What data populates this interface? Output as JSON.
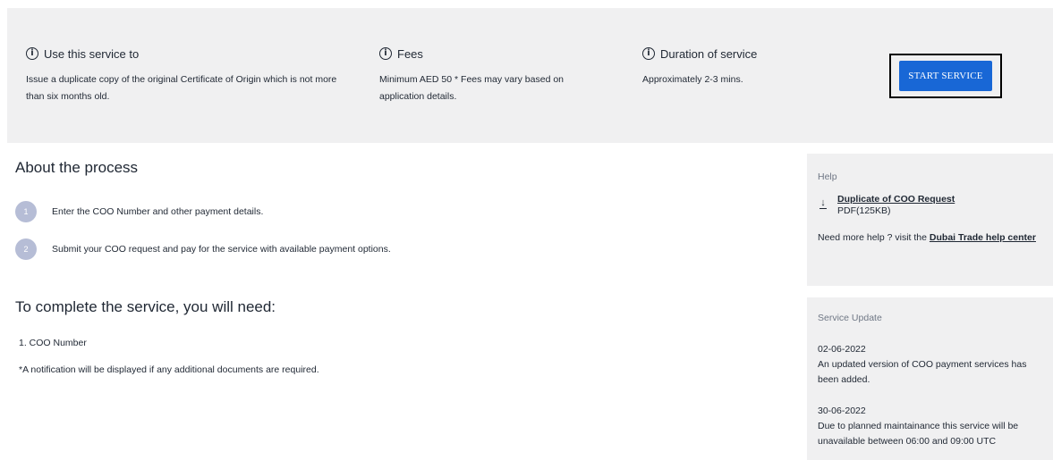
{
  "service_info": {
    "use": {
      "title": "Use this service to",
      "body": "Issue a duplicate copy of the original Certificate of Origin which is not more than six months old."
    },
    "fees": {
      "title": "Fees",
      "body": "Minimum AED 50 * Fees may vary based on application details."
    },
    "duration": {
      "title": "Duration of service",
      "body": "Approximately 2-3 mins."
    },
    "start_button": "START SERVICE",
    "info_icon_glyph": "i"
  },
  "about": {
    "title": "About the process",
    "steps": [
      {
        "number": "1",
        "text": "Enter the COO Number and other payment details."
      },
      {
        "number": "2",
        "text": "Submit your COO request and pay for the service with available payment options."
      }
    ]
  },
  "requirements": {
    "title": "To complete the service, you will need:",
    "items": [
      "1. COO Number"
    ],
    "note": "*A notification will be displayed if any additional documents are required."
  },
  "help": {
    "label": "Help",
    "document": {
      "name": "Duplicate of COO Request",
      "meta": "PDF(125KB)"
    },
    "more_help_prefix": "Need more help ? visit the ",
    "more_help_link": "Dubai Trade help center"
  },
  "service_update": {
    "label": "Service Update",
    "entries": [
      {
        "date": "02-06-2022",
        "text": "An updated version of COO payment services has been added."
      },
      {
        "date": "30-06-2022",
        "text": "Due to planned maintainance this service will be unavailable between 06:00 and 09:00 UTC"
      }
    ]
  },
  "colors": {
    "panel_bg": "#f0f0f1",
    "accent_button": "#1867d6",
    "step_circle": "#b6bdd6",
    "text": "#1f2733",
    "muted": "#6f7785"
  }
}
